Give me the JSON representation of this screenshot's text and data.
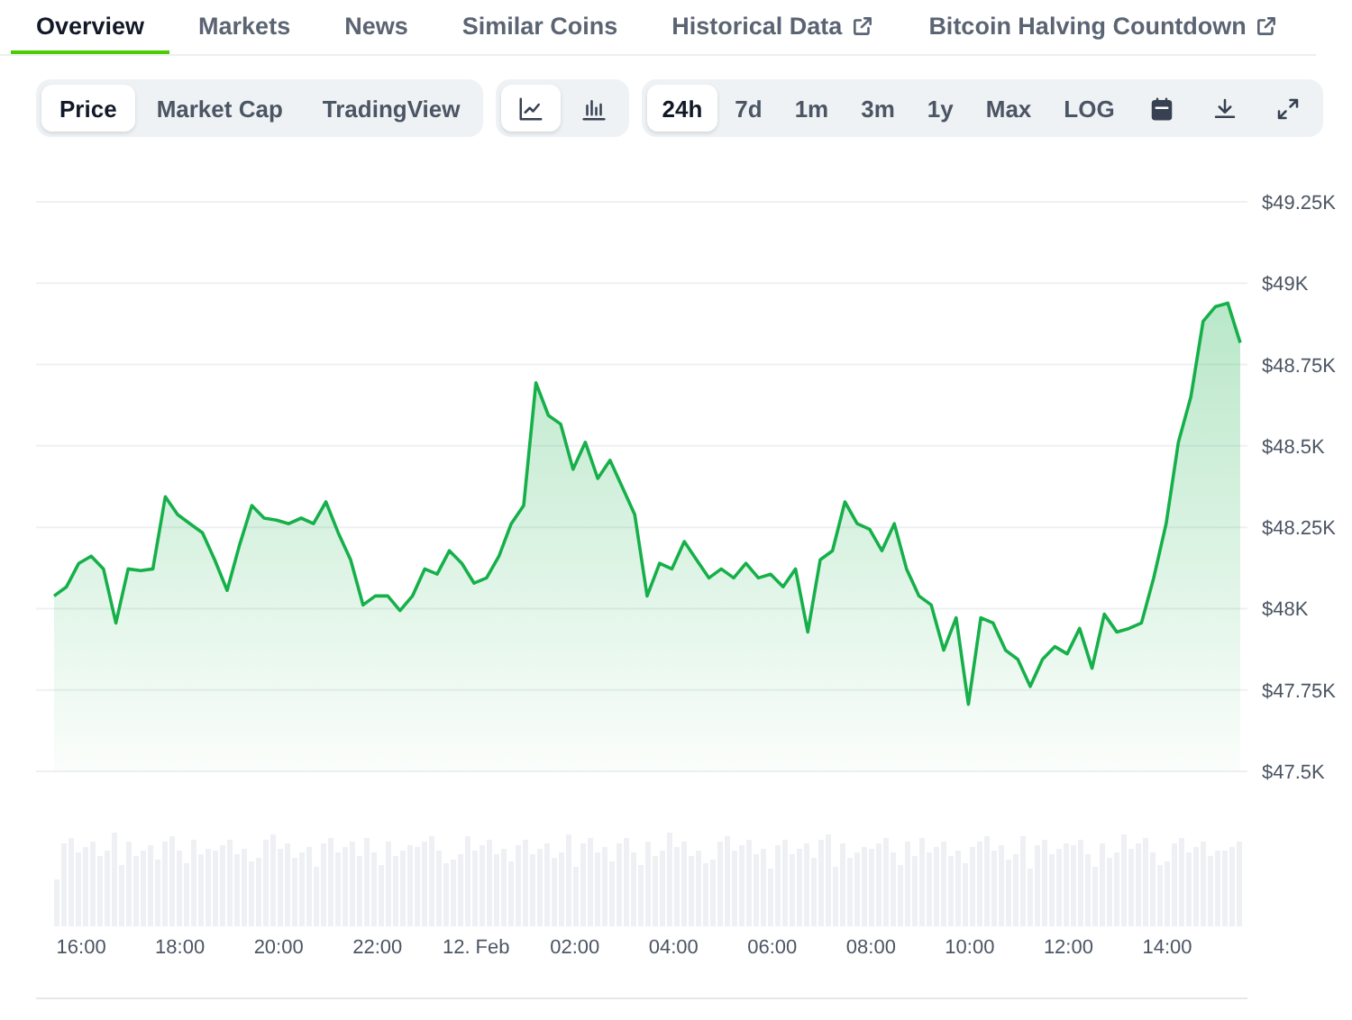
{
  "tabs": [
    {
      "label": "Overview",
      "selected": true,
      "external": false
    },
    {
      "label": "Markets",
      "selected": false,
      "external": false
    },
    {
      "label": "News",
      "selected": false,
      "external": false
    },
    {
      "label": "Similar Coins",
      "selected": false,
      "external": false
    },
    {
      "label": "Historical Data",
      "selected": false,
      "external": true
    },
    {
      "label": "Bitcoin Halving Countdown",
      "selected": false,
      "external": true
    }
  ],
  "view_modes": [
    {
      "label": "Price",
      "selected": true
    },
    {
      "label": "Market Cap",
      "selected": false
    },
    {
      "label": "TradingView",
      "selected": false
    }
  ],
  "chart_types": [
    {
      "kind": "line",
      "selected": true
    },
    {
      "kind": "candle",
      "selected": false
    }
  ],
  "ranges": [
    {
      "label": "24h",
      "selected": true
    },
    {
      "label": "7d",
      "selected": false
    },
    {
      "label": "1m",
      "selected": false
    },
    {
      "label": "3m",
      "selected": false
    },
    {
      "label": "1y",
      "selected": false
    },
    {
      "label": "Max",
      "selected": false
    },
    {
      "label": "LOG",
      "selected": false
    }
  ],
  "actions": [
    {
      "kind": "calendar"
    },
    {
      "kind": "download"
    },
    {
      "kind": "expand"
    }
  ],
  "time_axis": [
    "16:00",
    "18:00",
    "20:00",
    "22:00",
    "12. Feb",
    "02:00",
    "04:00",
    "06:00",
    "08:00",
    "10:00",
    "12:00",
    "14:00"
  ],
  "chart_data": {
    "type": "area",
    "grid": true,
    "ylim": [
      47.5,
      49.25
    ],
    "yticks": [
      {
        "value": 47.5,
        "label": "$47.5K"
      },
      {
        "value": 47.75,
        "label": "$47.75K"
      },
      {
        "value": 48,
        "label": "$48K"
      },
      {
        "value": 48.25,
        "label": "$48.25K"
      },
      {
        "value": 48.5,
        "label": "$48.5K"
      },
      {
        "value": 48.75,
        "label": "$48.75K"
      },
      {
        "value": 49,
        "label": "$49K"
      },
      {
        "value": 49.25,
        "label": "$49.25K"
      }
    ],
    "series": [
      {
        "color": "#16b04a",
        "values": [
          48.039,
          48.067,
          48.139,
          48.161,
          48.122,
          47.956,
          48.122,
          48.117,
          48.122,
          48.344,
          48.289,
          48.261,
          48.233,
          48.15,
          48.056,
          48.194,
          48.317,
          48.278,
          48.272,
          48.261,
          48.278,
          48.261,
          48.328,
          48.233,
          48.15,
          48.011,
          48.039,
          48.039,
          47.994,
          48.039,
          48.122,
          48.106,
          48.178,
          48.139,
          48.078,
          48.094,
          48.161,
          48.261,
          48.317,
          48.694,
          48.594,
          48.567,
          48.428,
          48.511,
          48.4,
          48.456,
          48.372,
          48.289,
          48.039,
          48.139,
          48.122,
          48.206,
          48.15,
          48.094,
          48.122,
          48.094,
          48.139,
          48.094,
          48.106,
          48.067,
          48.122,
          47.928,
          48.15,
          48.178,
          48.328,
          48.261,
          48.244,
          48.178,
          48.261,
          48.122,
          48.039,
          48.011,
          47.872,
          47.972,
          47.706,
          47.972,
          47.956,
          47.872,
          47.844,
          47.761,
          47.844,
          47.883,
          47.861,
          47.939,
          47.817,
          47.983,
          47.928,
          47.939,
          47.956,
          48.094,
          48.261,
          48.511,
          48.65,
          48.883,
          48.928,
          48.939,
          48.817
        ]
      }
    ]
  }
}
